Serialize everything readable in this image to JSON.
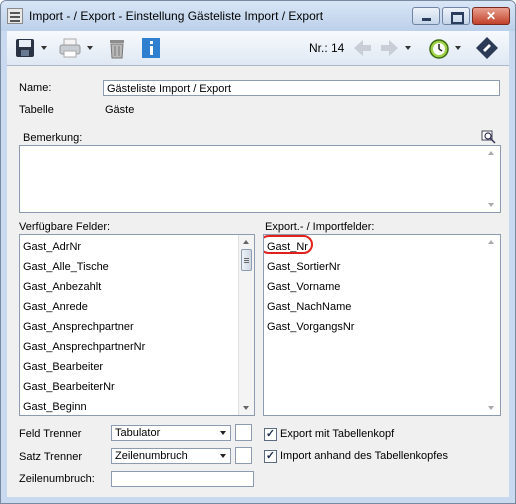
{
  "window": {
    "title": "Import - / Export - Einstellung Gästeliste Import / Export",
    "close_label": "✕"
  },
  "toolbar": {
    "nr_label": "Nr.: 14",
    "icons": [
      "save-icon",
      "print-icon",
      "trash-icon",
      "info-icon",
      "nav-back-icon",
      "nav-forward-icon",
      "clock-icon",
      "help-icon"
    ]
  },
  "form": {
    "name_label": "Name:",
    "name_value": "Gästeliste Import / Export",
    "tabelle_label": "Tabelle",
    "tabelle_value": "Gäste",
    "bemerkung_label": "Bemerkung:",
    "bemerkung_value": ""
  },
  "available_fields": {
    "label": "Verfügbare Felder:",
    "items": [
      "Gast_AdrNr",
      "Gast_Alle_Tische",
      "Gast_Anbezahlt",
      "Gast_Anrede",
      "Gast_Ansprechpartner",
      "Gast_AnsprechpartnerNr",
      "Gast_Bearbeiter",
      "Gast_BearbeiterNr",
      "Gast_Beginn"
    ]
  },
  "export_fields": {
    "label": "Export.- / Importfelder:",
    "items": [
      "Gast_Nr",
      "Gast_SortierNr",
      "Gast_Vorname",
      "Gast_NachName",
      "Gast_VorgangsNr"
    ]
  },
  "options": {
    "feld_trenner_label": "Feld Trenner",
    "feld_trenner_value": "Tabulator",
    "satz_trenner_label": "Satz Trenner",
    "satz_trenner_value": "Zeilenumbruch",
    "zeilenumbruch_label": "Zeilenumbruch:",
    "zeilenumbruch_value": "",
    "export_header_label": "Export mit Tabellenkopf",
    "export_header_checked": true,
    "import_header_label": "Import anhand des Tabellenkopfes",
    "import_header_checked": true,
    "check_mark": "✓"
  }
}
